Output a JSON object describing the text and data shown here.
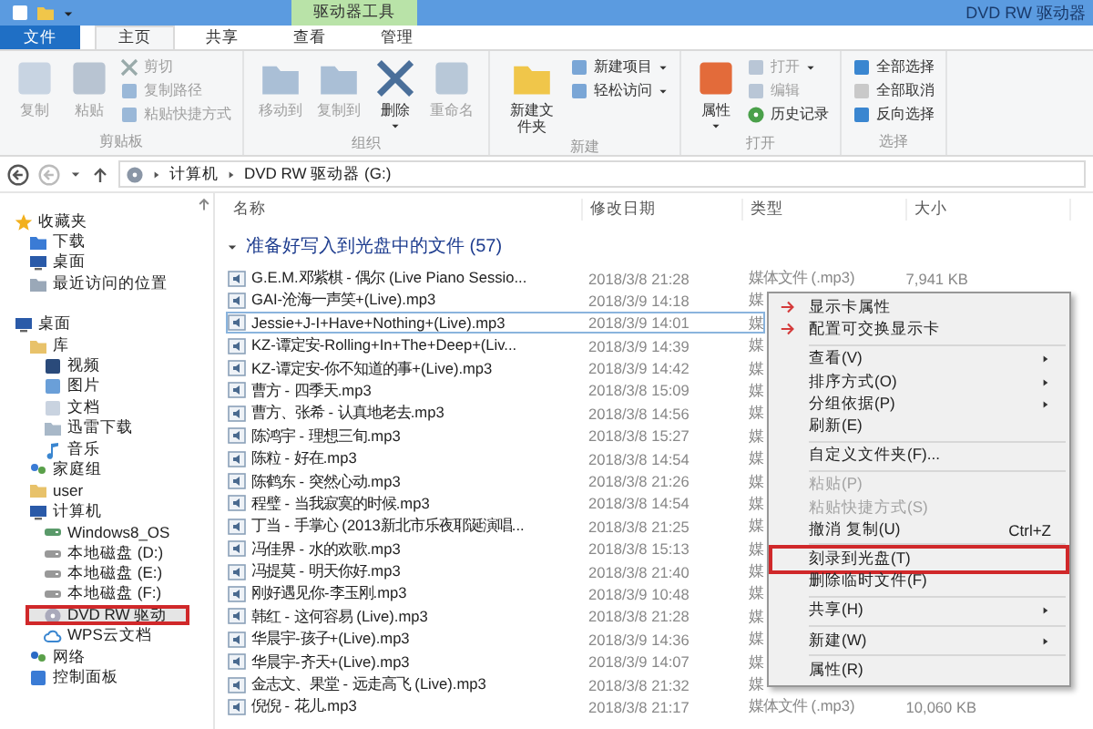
{
  "title_bar": {
    "context_tab": "驱动器工具",
    "title": "DVD RW 驱动器"
  },
  "tabs": [
    {
      "label": "文件",
      "kind": "file",
      "selected": false
    },
    {
      "label": "主页",
      "kind": "tab",
      "selected": true
    },
    {
      "label": "共享",
      "kind": "tab",
      "selected": false
    },
    {
      "label": "查看",
      "kind": "tab",
      "selected": false
    },
    {
      "label": "管理",
      "kind": "tab",
      "selected": false
    }
  ],
  "ribbon": [
    {
      "label": "剪贴板",
      "buttons": [
        {
          "label": "复制",
          "kind": "large",
          "disabled": true
        },
        {
          "label": "粘贴",
          "kind": "large",
          "disabled": true
        },
        {
          "label": "剪切",
          "kind": "small",
          "disabled": true
        },
        {
          "label": "复制路径",
          "kind": "small",
          "disabled": true
        },
        {
          "label": "粘贴快捷方式",
          "kind": "small",
          "disabled": true
        }
      ]
    },
    {
      "label": "组织",
      "buttons": [
        {
          "label": "移动到",
          "kind": "large",
          "disabled": true
        },
        {
          "label": "复制到",
          "kind": "large",
          "disabled": true
        },
        {
          "label": "删除",
          "kind": "large",
          "disabled": false,
          "dropdown": true
        },
        {
          "label": "重命名",
          "kind": "large",
          "disabled": true
        }
      ]
    },
    {
      "label": "新建",
      "buttons": [
        {
          "label": "新建文件夹",
          "kind": "large",
          "disabled": false
        },
        {
          "label": "新建项目",
          "kind": "small",
          "disabled": false,
          "dropdown": true
        },
        {
          "label": "轻松访问",
          "kind": "small",
          "disabled": false,
          "dropdown": true
        }
      ]
    },
    {
      "label": "打开",
      "buttons": [
        {
          "label": "属性",
          "kind": "large",
          "disabled": false,
          "dropdown": true
        },
        {
          "label": "打开",
          "kind": "small",
          "disabled": true,
          "dropdown": true
        },
        {
          "label": "编辑",
          "kind": "small",
          "disabled": true
        },
        {
          "label": "历史记录",
          "kind": "small",
          "disabled": false
        }
      ]
    },
    {
      "label": "选择",
      "buttons": [
        {
          "label": "全部选择",
          "kind": "small",
          "disabled": false
        },
        {
          "label": "全部取消",
          "kind": "small",
          "disabled": false
        },
        {
          "label": "反向选择",
          "kind": "small",
          "disabled": false
        }
      ]
    }
  ],
  "address": {
    "path": [
      "计算机",
      "DVD RW 驱动器 (G:)"
    ]
  },
  "sidebar": [
    {
      "label": "收藏夹",
      "selected": false,
      "children": [
        {
          "label": "下载",
          "selected": false
        },
        {
          "label": "桌面",
          "selected": false
        },
        {
          "label": "最近访问的位置",
          "selected": false
        }
      ]
    },
    {
      "label": "桌面",
      "selected": false,
      "children": [
        {
          "label": "库",
          "selected": false,
          "children": [
            {
              "label": "视频",
              "selected": false
            },
            {
              "label": "图片",
              "selected": false
            },
            {
              "label": "文档",
              "selected": false
            },
            {
              "label": "迅雷下载",
              "selected": false
            },
            {
              "label": "音乐",
              "selected": false
            }
          ]
        },
        {
          "label": "家庭组",
          "selected": false
        },
        {
          "label": "user",
          "selected": false
        },
        {
          "label": "计算机",
          "selected": false,
          "children": [
            {
              "label": "Windows8_OS",
              "selected": false
            },
            {
              "label": "本地磁盘 (D:)",
              "selected": false
            },
            {
              "label": "本地磁盘 (E:)",
              "selected": false
            },
            {
              "label": "本地磁盘 (F:)",
              "selected": false
            },
            {
              "label": "DVD RW 驱动",
              "selected": true
            },
            {
              "label": "WPS云文档",
              "selected": false
            }
          ]
        },
        {
          "label": "网络",
          "selected": false
        },
        {
          "label": "控制面板",
          "selected": false
        }
      ]
    }
  ],
  "columns": [
    "名称",
    "修改日期",
    "类型",
    "大小"
  ],
  "group": {
    "label": "准备好写入到光盘中的文件 (57)",
    "expanded": true
  },
  "rows": [
    {
      "name": "G.E.M.邓紫棋 - 偶尔 (Live Piano Sessio...",
      "modified": "2018/3/8 21:28",
      "type": "媒体文件 (.mp3)",
      "size": "7,941 KB",
      "selected": false
    },
    {
      "name": "GAI-沧海一声笑+(Live).mp3",
      "modified": "2018/3/9 14:18",
      "type": "媒",
      "selected": false
    },
    {
      "name": "Jessie+J-I+Have+Nothing+(Live).mp3",
      "modified": "2018/3/9 14:01",
      "type": "媒",
      "selected": true
    },
    {
      "name": "KZ-谭定安-Rolling+In+The+Deep+(Liv...",
      "modified": "2018/3/9 14:39",
      "type": "媒",
      "selected": false
    },
    {
      "name": "KZ-谭定安-你不知道的事+(Live).mp3",
      "modified": "2018/3/9 14:42",
      "type": "媒",
      "selected": false
    },
    {
      "name": "曹方 - 四季天.mp3",
      "modified": "2018/3/8 15:09",
      "type": "媒",
      "selected": false
    },
    {
      "name": "曹方、张希 - 认真地老去.mp3",
      "modified": "2018/3/8 14:56",
      "type": "媒",
      "selected": false
    },
    {
      "name": "陈鸿宇 - 理想三旬.mp3",
      "modified": "2018/3/8 15:27",
      "type": "媒",
      "selected": false
    },
    {
      "name": "陈粒 - 好在.mp3",
      "modified": "2018/3/8 14:54",
      "type": "媒",
      "selected": false
    },
    {
      "name": "陈鹤东 - 突然心动.mp3",
      "modified": "2018/3/8 21:26",
      "type": "媒",
      "selected": false
    },
    {
      "name": "程璧 - 当我寂寞的时候.mp3",
      "modified": "2018/3/8 14:54",
      "type": "媒",
      "selected": false
    },
    {
      "name": "丁当 - 手掌心 (2013新北市乐夜耶诞演唱...",
      "modified": "2018/3/8 21:25",
      "type": "媒",
      "selected": false
    },
    {
      "name": "冯佳界 - 水的欢歌.mp3",
      "modified": "2018/3/8 15:13",
      "type": "媒",
      "selected": false
    },
    {
      "name": "冯提莫 - 明天你好.mp3",
      "modified": "2018/3/8 21:40",
      "type": "媒",
      "selected": false
    },
    {
      "name": "刚好遇见你-李玉刚.mp3",
      "modified": "2018/3/9 10:48",
      "type": "媒",
      "selected": false
    },
    {
      "name": "韩红 - 这何容易 (Live).mp3",
      "modified": "2018/3/8 21:28",
      "type": "媒",
      "selected": false
    },
    {
      "name": "华晨宇-孩子+(Live).mp3",
      "modified": "2018/3/9 14:36",
      "type": "媒",
      "selected": false
    },
    {
      "name": "华晨宇-齐天+(Live).mp3",
      "modified": "2018/3/9 14:07",
      "type": "媒",
      "selected": false
    },
    {
      "name": "金志文、果堂 - 远走高飞 (Live).mp3",
      "modified": "2018/3/8 21:32",
      "type": "媒",
      "selected": false
    },
    {
      "name": "倪倪 - 花儿.mp3",
      "modified": "2018/3/8 21:17",
      "type": "媒体文件 (.mp3)",
      "size": "10,060 KB",
      "selected": false
    }
  ],
  "context_menu": [
    {
      "kind": "graphics",
      "label": "显示卡属性",
      "marked": false
    },
    {
      "kind": "graphics",
      "label": "配置可交换显示卡",
      "marked": false
    },
    {
      "kind": "separator"
    },
    {
      "kind": "item",
      "label": "查看(V)",
      "submenu": true,
      "disabled": false,
      "marked": false
    },
    {
      "kind": "item",
      "label": "排序方式(O)",
      "submenu": true,
      "disabled": false,
      "marked": false
    },
    {
      "kind": "item",
      "label": "分组依据(P)",
      "submenu": true,
      "disabled": false,
      "marked": false
    },
    {
      "kind": "item",
      "label": "刷新(E)",
      "submenu": false,
      "disabled": false,
      "marked": false
    },
    {
      "kind": "separator"
    },
    {
      "kind": "item",
      "label": "自定义文件夹(F)...",
      "submenu": false,
      "disabled": false,
      "marked": false
    },
    {
      "kind": "separator"
    },
    {
      "kind": "item",
      "label": "粘贴(P)",
      "submenu": false,
      "disabled": true,
      "marked": false
    },
    {
      "kind": "item",
      "label": "粘贴快捷方式(S)",
      "submenu": false,
      "disabled": true,
      "marked": false
    },
    {
      "kind": "item",
      "label": "撤消 复制(U)",
      "shortcut": "Ctrl+Z",
      "submenu": false,
      "disabled": false,
      "marked": false
    },
    {
      "kind": "separator"
    },
    {
      "kind": "item",
      "label": "刻录到光盘(T)",
      "submenu": false,
      "disabled": false,
      "marked": true
    },
    {
      "kind": "item",
      "label": "删除临时文件(F)",
      "submenu": false,
      "disabled": false,
      "marked": false
    },
    {
      "kind": "separator"
    },
    {
      "kind": "item",
      "label": "共享(H)",
      "submenu": true,
      "disabled": false,
      "marked": false
    },
    {
      "kind": "separator"
    },
    {
      "kind": "item",
      "label": "新建(W)",
      "submenu": true,
      "disabled": false,
      "marked": false
    },
    {
      "kind": "separator"
    },
    {
      "kind": "item",
      "label": "属性(R)",
      "submenu": false,
      "disabled": false,
      "marked": false
    }
  ]
}
